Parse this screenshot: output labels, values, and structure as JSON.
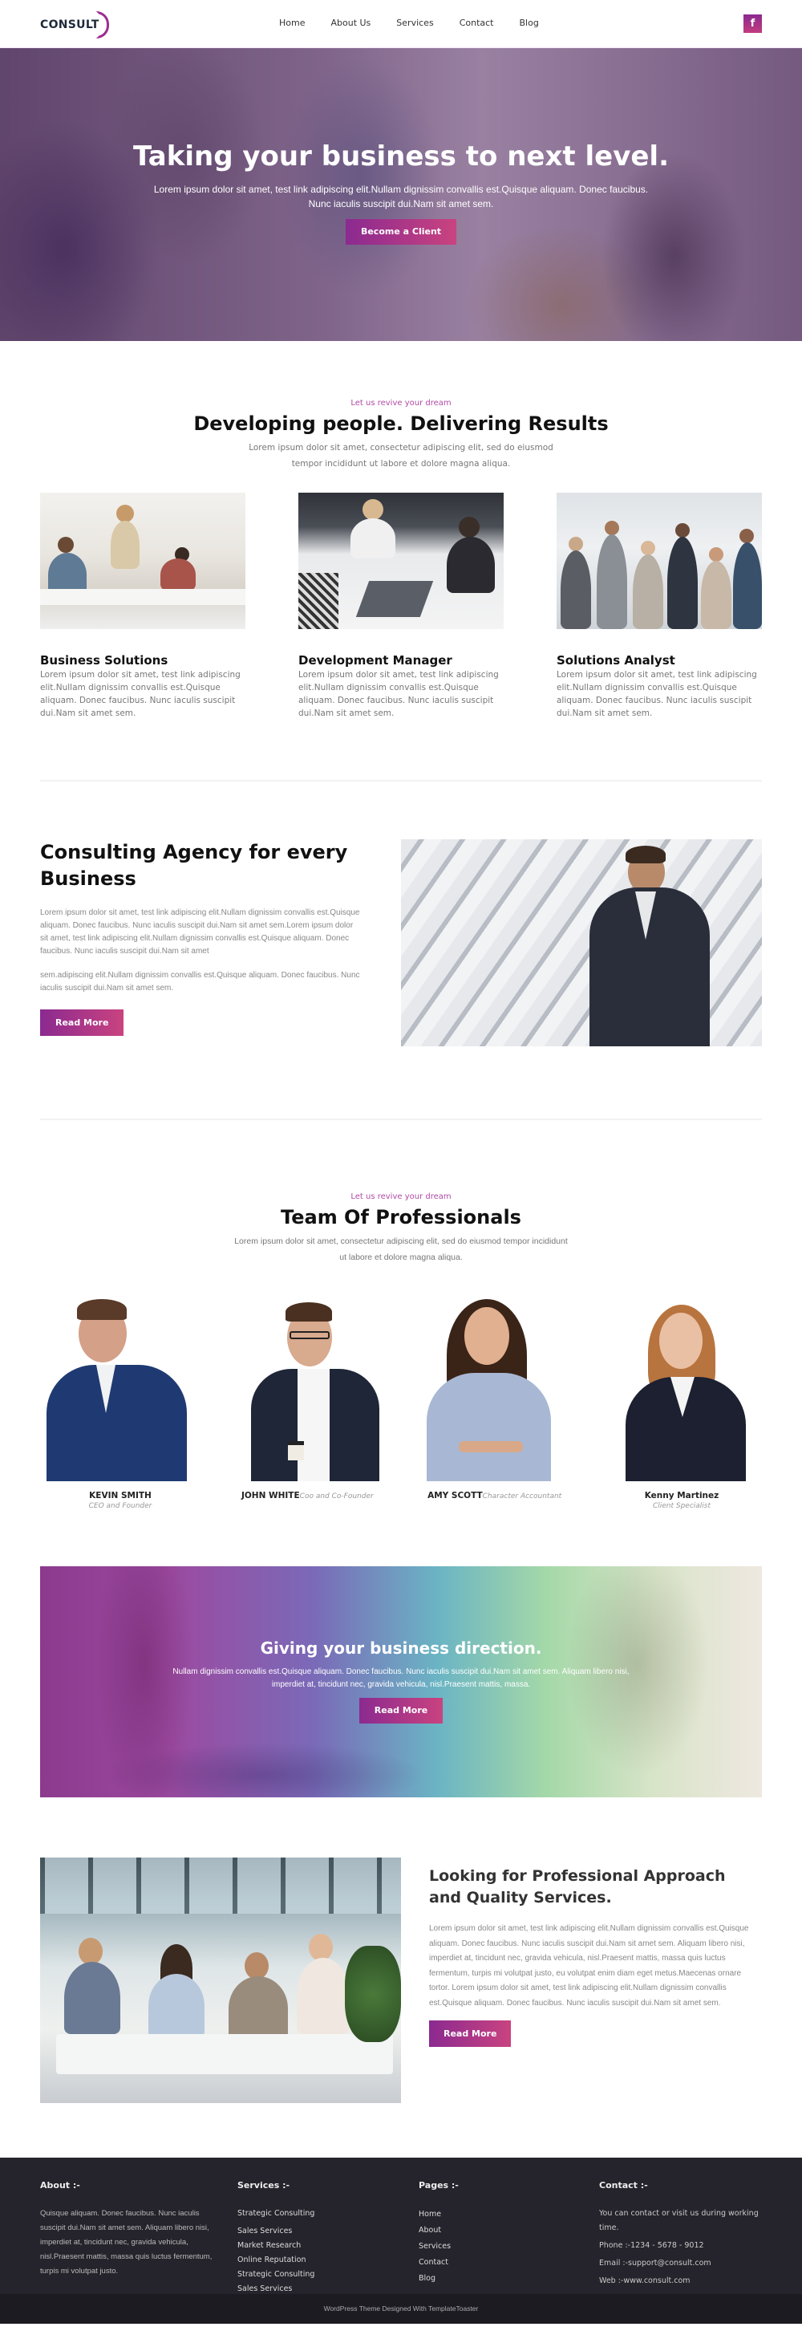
{
  "header": {
    "logo": "CONSULT",
    "nav": [
      "Home",
      "About Us",
      "Services",
      "Contact",
      "Blog"
    ],
    "social_icon": "f"
  },
  "hero": {
    "title": "Taking your business to next level.",
    "text": "Lorem ipsum dolor sit amet, test link adipiscing elit.Nullam dignissim convallis est.Quisque aliquam. Donec faucibus. Nunc iaculis suscipit dui.Nam sit amet sem.",
    "button": "Become a Client",
    "slides": 3
  },
  "intro": {
    "kicker": "Let us revive your dream",
    "title": "Developing people. Delivering Results",
    "subtitle": "Lorem ipsum dolor sit amet, consectetur adipiscing elit, sed do eiusmod tempor incididunt ut labore et dolore magna aliqua.",
    "features": [
      {
        "title": "Business Solutions",
        "text": "Lorem ipsum dolor sit amet, test link adipiscing elit.Nullam dignissim convallis est.Quisque aliquam. Donec faucibus. Nunc iaculis suscipit dui.Nam sit amet sem."
      },
      {
        "title": "Development Manager",
        "text": "Lorem ipsum dolor sit amet, test link adipiscing elit.Nullam dignissim convallis est.Quisque aliquam. Donec faucibus. Nunc iaculis suscipit dui.Nam sit amet sem."
      },
      {
        "title": "Solutions Analyst",
        "text": "Lorem ipsum dolor sit amet, test link adipiscing elit.Nullam dignissim convallis est.Quisque aliquam. Donec faucibus. Nunc iaculis suscipit dui.Nam sit amet sem."
      }
    ]
  },
  "agency": {
    "title": "Consulting Agency for every Business",
    "para1": "Lorem ipsum dolor sit amet, test link adipiscing elit.Nullam dignissim convallis est.Quisque aliquam. Donec faucibus. Nunc iaculis suscipit dui.Nam sit amet sem.Lorem ipsum dolor sit amet, test link adipiscing elit.Nullam dignissim convallis est.Quisque aliquam. Donec faucibus. Nunc iaculis suscipit dui.Nam sit amet",
    "para2": "sem.adipiscing elit.Nullam dignissim convallis est.Quisque aliquam. Donec faucibus. Nunc iaculis suscipit dui.Nam sit amet sem.",
    "button": "Read More"
  },
  "team": {
    "kicker": "Let us revive your dream",
    "title": "Team Of Professionals",
    "subtitle": "Lorem ipsum dolor sit amet, consectetur adipiscing elit, sed do eiusmod tempor incididunt ut labore et dolore magna aliqua.",
    "members": [
      {
        "name": "KEVIN SMITH",
        "role": "CEO and Founder"
      },
      {
        "name": "JOHN WHITE",
        "role": "Coo and Co-Founder"
      },
      {
        "name": "AMY SCOTT",
        "role": "Character Accountant"
      },
      {
        "name": "Kenny Martinez",
        "role": "Client Specialist"
      }
    ]
  },
  "direction": {
    "title": "Giving your business direction.",
    "text": "Nullam dignissim convallis est.Quisque aliquam. Donec faucibus. Nunc iaculis suscipit dui.Nam sit amet sem. Aliquam libero nisi, imperdiet at, tincidunt nec, gravida vehicula, nisl.Praesent mattis, massa.",
    "button": "Read More"
  },
  "quality": {
    "title": "Looking for Professional Approach and Quality Services.",
    "text": "Lorem ipsum dolor sit amet, test link adipiscing elit.Nullam dignissim convallis est.Quisque aliquam. Donec faucibus. Nunc iaculis suscipit dui.Nam sit amet sem. Aliquam libero nisi, imperdiet at, tincidunt nec, gravida vehicula, nisl.Praesent mattis, massa quis luctus fermentum, turpis mi volutpat justo, eu volutpat enim diam eget metus.Maecenas ornare tortor. Lorem ipsum dolor sit amet, test link adipiscing elit.Nullam dignissim convallis est.Quisque aliquam. Donec faucibus. Nunc iaculis suscipit dui.Nam sit amet sem.",
    "button": "Read More"
  },
  "footer": {
    "about": {
      "title": "About :-",
      "text": "Quisque aliquam. Donec faucibus. Nunc iaculis suscipit dui.Nam sit amet sem. Aliquam libero nisi, imperdiet at, tincidunt nec, gravida vehicula, nisl.Praesent mattis, massa quis luctus fermentum, turpis mi volutpat justo."
    },
    "services": {
      "title": "Services :-",
      "items": [
        "Strategic Consulting",
        "Sales Services",
        "Market Research",
        "Online Reputation",
        "Strategic Consulting",
        "Sales Services"
      ]
    },
    "pages": {
      "title": "Pages :-",
      "items": [
        "Home",
        "About",
        "Services",
        "Contact",
        "Blog"
      ]
    },
    "contact": {
      "title": "Contact :-",
      "intro": "You can contact or visit us during working time.",
      "phone": "Phone :-1234 - 5678 - 9012",
      "email": "Email :-support@consult.com",
      "web": "Web :-www.consult.com"
    },
    "copyright": "WordPress Theme Designed With TemplateToaster"
  },
  "colors": {
    "accent": "#9b2d8f",
    "accent_end": "#c9437f",
    "kicker": "#b04aa6",
    "footer_bg": "#25232b",
    "copyright_bg": "#1d1b22"
  }
}
